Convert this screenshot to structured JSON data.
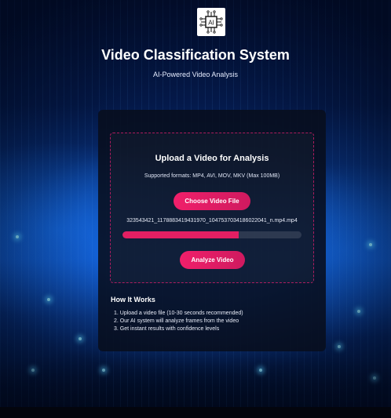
{
  "header": {
    "logo_text": "AI",
    "title": "Video Classification System",
    "subtitle": "AI-Powered Video Analysis"
  },
  "upload": {
    "heading": "Upload a Video for Analysis",
    "formats": "Supported formats: MP4, AVI, MOV, MKV (Max 100MB)",
    "choose_label": "Choose Video File",
    "filename": "323543421_1178883419431970_1047537034186022041_n.mp4.mp4",
    "progress_fraction": 0.65,
    "analyze_label": "Analyze Video"
  },
  "how_it_works": {
    "heading": "How It Works",
    "steps": [
      "1. Upload a video file (10-30 seconds recommended)",
      "2. Our AI system will analyze frames from the video",
      "3. Get instant results with confidence levels"
    ]
  },
  "colors": {
    "accent": "#e31f63",
    "panel": "#080e1c",
    "background": "#041a4c"
  }
}
